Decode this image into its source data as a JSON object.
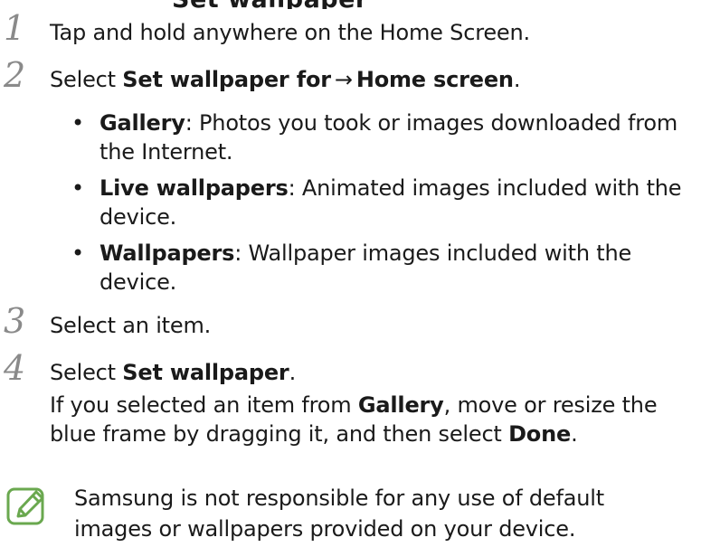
{
  "header": {
    "cut_text": "Set wallpaper"
  },
  "steps": [
    {
      "number": "1",
      "text": "Tap and hold anywhere on the Home Screen."
    },
    {
      "number": "2",
      "prefix": "Select ",
      "bold1": "Set wallpaper for",
      "arrow": "→",
      "bold2": "Home screen",
      "suffix": ".",
      "bullets": [
        {
          "term": "Gallery",
          "line1": ": Photos you took or images downloaded from",
          "line2": "the Internet."
        },
        {
          "term": "Live wallpapers",
          "line1": ": Animated images included with the",
          "line2": "device."
        },
        {
          "term": "Wallpapers",
          "line1": ": Wallpaper images included with the",
          "line2": "device."
        }
      ]
    },
    {
      "number": "3",
      "text": "Select an item."
    },
    {
      "number": "4",
      "prefix": "Select ",
      "bold": "Set wallpaper",
      "suffix": ".",
      "detail": {
        "p1": "If you selected an item from ",
        "b1": "Gallery",
        "p2": ", move or resize the",
        "p3": "blue frame by dragging it, and then select ",
        "b2": "Done",
        "p4": "."
      }
    }
  ],
  "note": {
    "icon": "note-pencil-icon",
    "icon_color": "#6aa84f",
    "line1": "Samsung is not responsible for any use of default",
    "line2": "images or wallpapers provided on your device."
  },
  "colors": {
    "text": "#1a1a1a",
    "step_number": "#8a8a8a",
    "note_icon": "#6aa84f"
  }
}
